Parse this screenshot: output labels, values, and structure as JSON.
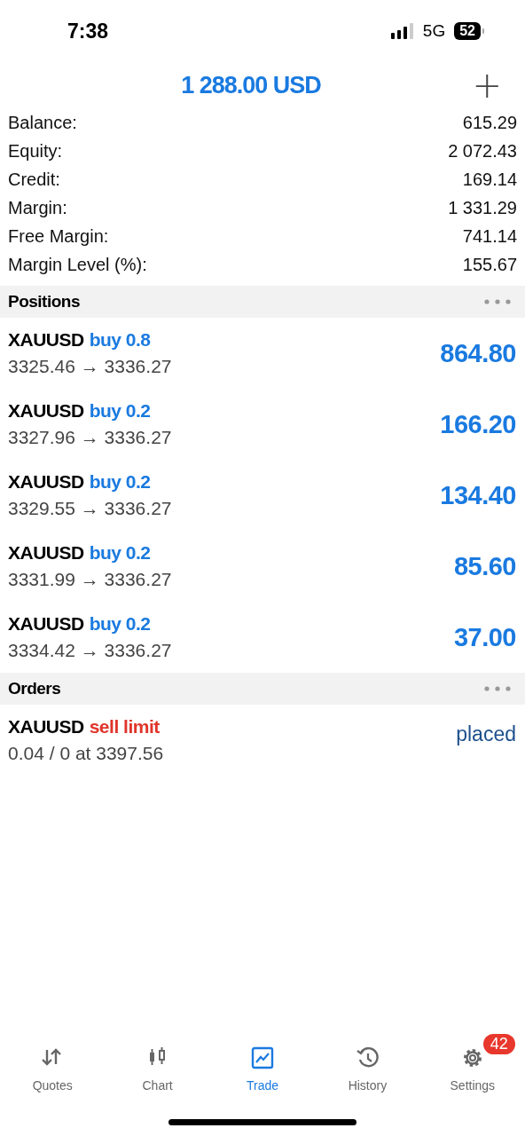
{
  "status_bar": {
    "time": "7:38",
    "network": "5G",
    "battery": "52"
  },
  "header": {
    "title": "1 288.00 USD",
    "add_icon": "+"
  },
  "account": [
    {
      "label": "Balance:",
      "value": "615.29"
    },
    {
      "label": "Equity:",
      "value": "2 072.43"
    },
    {
      "label": "Credit:",
      "value": "169.14"
    },
    {
      "label": "Margin:",
      "value": "1 331.29"
    },
    {
      "label": "Free Margin:",
      "value": "741.14"
    },
    {
      "label": "Margin Level (%):",
      "value": "155.67"
    }
  ],
  "positions": {
    "title": "Positions",
    "items": [
      {
        "symbol": "XAUUSD",
        "kind": "buy",
        "trade": "buy 0.8",
        "prices": "3325.46 → 3336.27",
        "profit": "864.80"
      },
      {
        "symbol": "XAUUSD",
        "kind": "buy",
        "trade": "buy 0.2",
        "prices": "3327.96 → 3336.27",
        "profit": "166.20"
      },
      {
        "symbol": "XAUUSD",
        "kind": "buy",
        "trade": "buy 0.2",
        "prices": "3329.55 → 3336.27",
        "profit": "134.40"
      },
      {
        "symbol": "XAUUSD",
        "kind": "buy",
        "trade": "buy 0.2",
        "prices": "3331.99 → 3336.27",
        "profit": "85.60"
      },
      {
        "symbol": "XAUUSD",
        "kind": "buy",
        "trade": "buy 0.2",
        "prices": "3334.42 → 3336.27",
        "profit": "37.00"
      }
    ]
  },
  "orders": {
    "title": "Orders",
    "items": [
      {
        "symbol": "XAUUSD",
        "kind": "sell",
        "trade": "sell limit",
        "details": "0.04 / 0 at 3397.56",
        "state": "placed"
      }
    ]
  },
  "tab_bar": [
    {
      "label": "Quotes",
      "kind": "quotes",
      "selected": false
    },
    {
      "label": "Chart",
      "kind": "chart",
      "selected": false
    },
    {
      "label": "Trade",
      "kind": "trade",
      "selected": true
    },
    {
      "label": "History",
      "kind": "history",
      "selected": false
    },
    {
      "label": "Settings",
      "kind": "settings",
      "selected": false,
      "badge": "42"
    }
  ]
}
